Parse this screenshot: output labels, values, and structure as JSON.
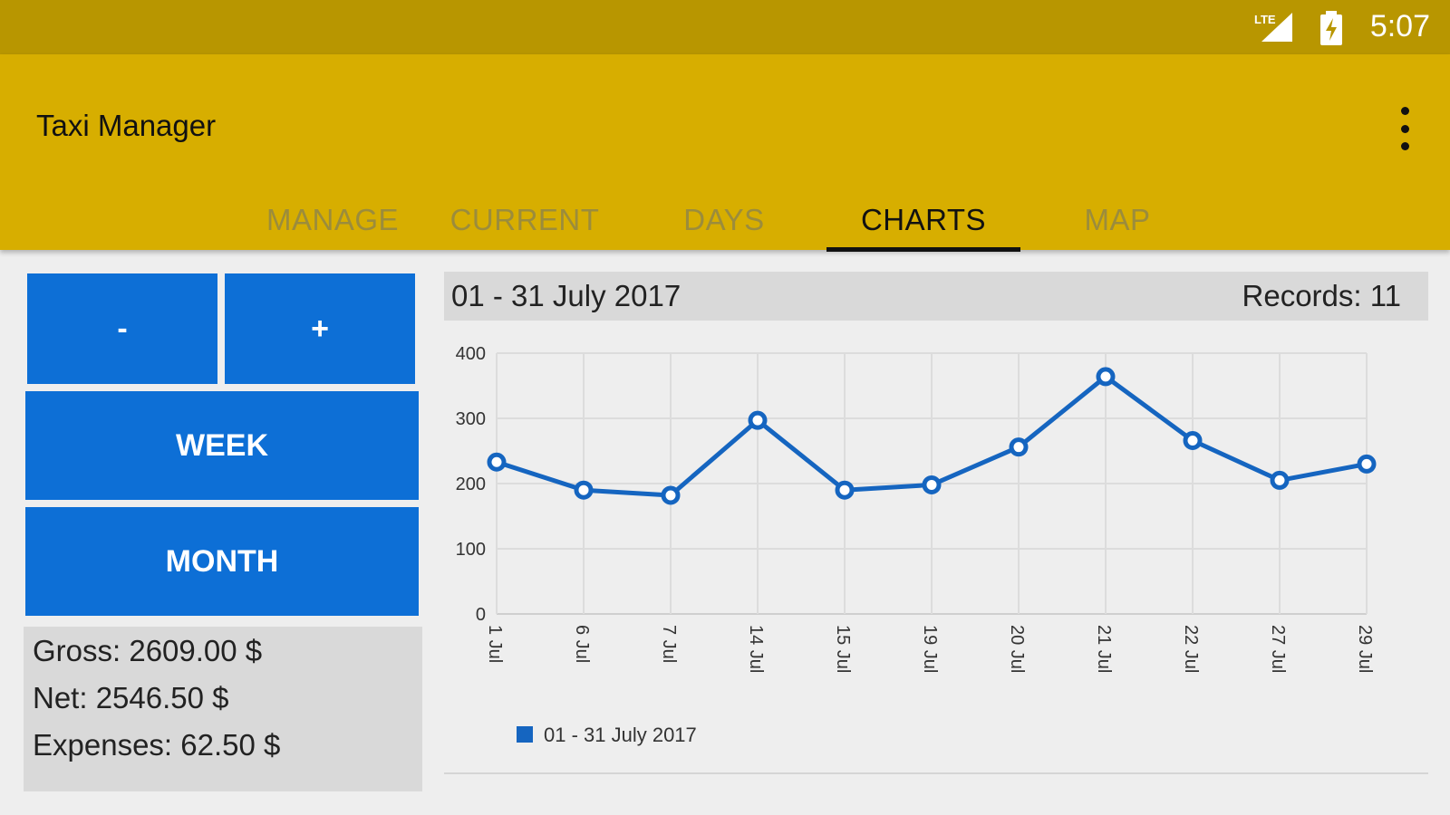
{
  "status_bar": {
    "time": "5:07",
    "network": "LTE",
    "icons": [
      "lte-signal-icon",
      "battery-charging-icon"
    ]
  },
  "app_bar": {
    "title": "Taxi Manager",
    "menu_icon": "overflow-menu-icon"
  },
  "tabs": [
    {
      "label": "MANAGE",
      "active": false
    },
    {
      "label": "CURRENT",
      "active": false
    },
    {
      "label": "DAYS",
      "active": false
    },
    {
      "label": "CHARTS",
      "active": true
    },
    {
      "label": "MAP",
      "active": false
    }
  ],
  "controls": {
    "minus_label": "-",
    "plus_label": "+",
    "week_label": "WEEK",
    "month_label": "MONTH"
  },
  "stats": {
    "gross": "Gross: 2609.00 $",
    "net": "Net: 2546.50 $",
    "expenses": "Expenses: 62.50 $"
  },
  "chart_header": {
    "period": "01 - 31 July 2017",
    "records": "Records: 11"
  },
  "colors": {
    "status_bar": "#b89600",
    "app_bar": "#d7ae00",
    "button": "#0d6fd6",
    "series": "#1565c0"
  },
  "chart_data": {
    "type": "line",
    "categories": [
      "1 Jul",
      "6 Jul",
      "7 Jul",
      "14 Jul",
      "15 Jul",
      "19 Jul",
      "20 Jul",
      "21 Jul",
      "22 Jul",
      "27 Jul",
      "29 Jul"
    ],
    "series": [
      {
        "name": "01 - 31 July 2017",
        "values": [
          233,
          190,
          182,
          297,
          190,
          198,
          256,
          364,
          266,
          205,
          230
        ]
      }
    ],
    "yticks": [
      0,
      100,
      200,
      300,
      400
    ],
    "ylim": [
      0,
      400
    ],
    "grid": true,
    "legend_position": "bottom-left"
  }
}
